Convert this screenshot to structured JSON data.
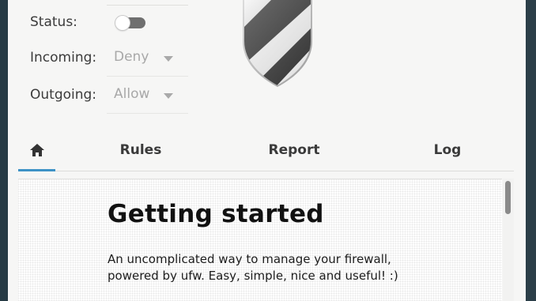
{
  "status": {
    "label": "Status:",
    "enabled": false
  },
  "incoming": {
    "label": "Incoming:",
    "value": "Deny"
  },
  "outgoing": {
    "label": "Outgoing:",
    "value": "Allow"
  },
  "tabs": [
    {
      "label": "",
      "icon": "home-icon",
      "active": true
    },
    {
      "label": "Rules",
      "active": false
    },
    {
      "label": "Report",
      "active": false
    },
    {
      "label": "Log",
      "active": false
    }
  ],
  "content": {
    "heading": "Getting started",
    "description": "An uncomplicated way to manage your firewall, powered by ufw. Easy, simple, nice and useful! :)"
  },
  "colors": {
    "accent": "#3d92c6",
    "window_bg": "#f6f6f5",
    "frame_bg": "#263a44"
  }
}
